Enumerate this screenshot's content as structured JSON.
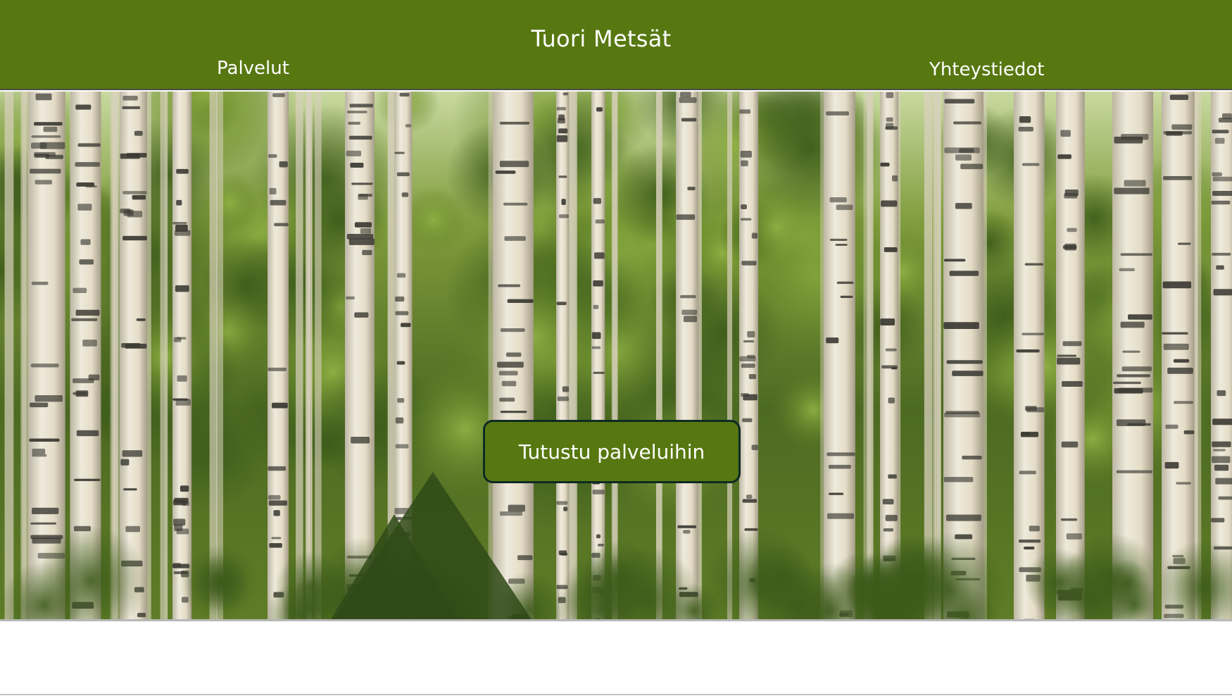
{
  "header": {
    "title": "Tuori Metsät",
    "nav": {
      "services_label": "Palvelut",
      "contact_label": "Yhteystiedot"
    }
  },
  "hero": {
    "background_image": "birch-forest-photo",
    "cta_label": "Tutustu palveluihin"
  },
  "colors": {
    "brand_green": "#577811",
    "button_border": "#0e2a22",
    "text_light": "#ffffff"
  }
}
